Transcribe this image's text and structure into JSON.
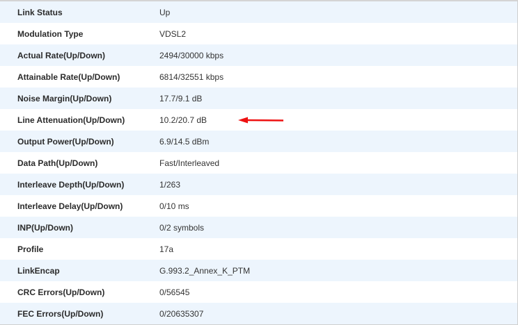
{
  "rows": [
    {
      "label": "Link Status",
      "value": "Up"
    },
    {
      "label": "Modulation Type",
      "value": "VDSL2"
    },
    {
      "label": "Actual Rate(Up/Down)",
      "value": "2494/30000 kbps"
    },
    {
      "label": "Attainable Rate(Up/Down)",
      "value": "6814/32551 kbps"
    },
    {
      "label": "Noise Margin(Up/Down)",
      "value": "17.7/9.1 dB"
    },
    {
      "label": "Line Attenuation(Up/Down)",
      "value": "10.2/20.7 dB"
    },
    {
      "label": "Output Power(Up/Down)",
      "value": "6.9/14.5 dBm"
    },
    {
      "label": "Data Path(Up/Down)",
      "value": "Fast/Interleaved"
    },
    {
      "label": "Interleave Depth(Up/Down)",
      "value": "1/263"
    },
    {
      "label": "Interleave Delay(Up/Down)",
      "value": "0/10 ms"
    },
    {
      "label": "INP(Up/Down)",
      "value": "0/2 symbols"
    },
    {
      "label": "Profile",
      "value": "17a"
    },
    {
      "label": "LinkEncap",
      "value": "G.993.2_Annex_K_PTM"
    },
    {
      "label": "CRC Errors(Up/Down)",
      "value": "0/56545"
    },
    {
      "label": "FEC Errors(Up/Down)",
      "value": "0/20635307"
    }
  ],
  "annotation": {
    "icon": "red-arrow-icon",
    "color": "#ee1111"
  }
}
